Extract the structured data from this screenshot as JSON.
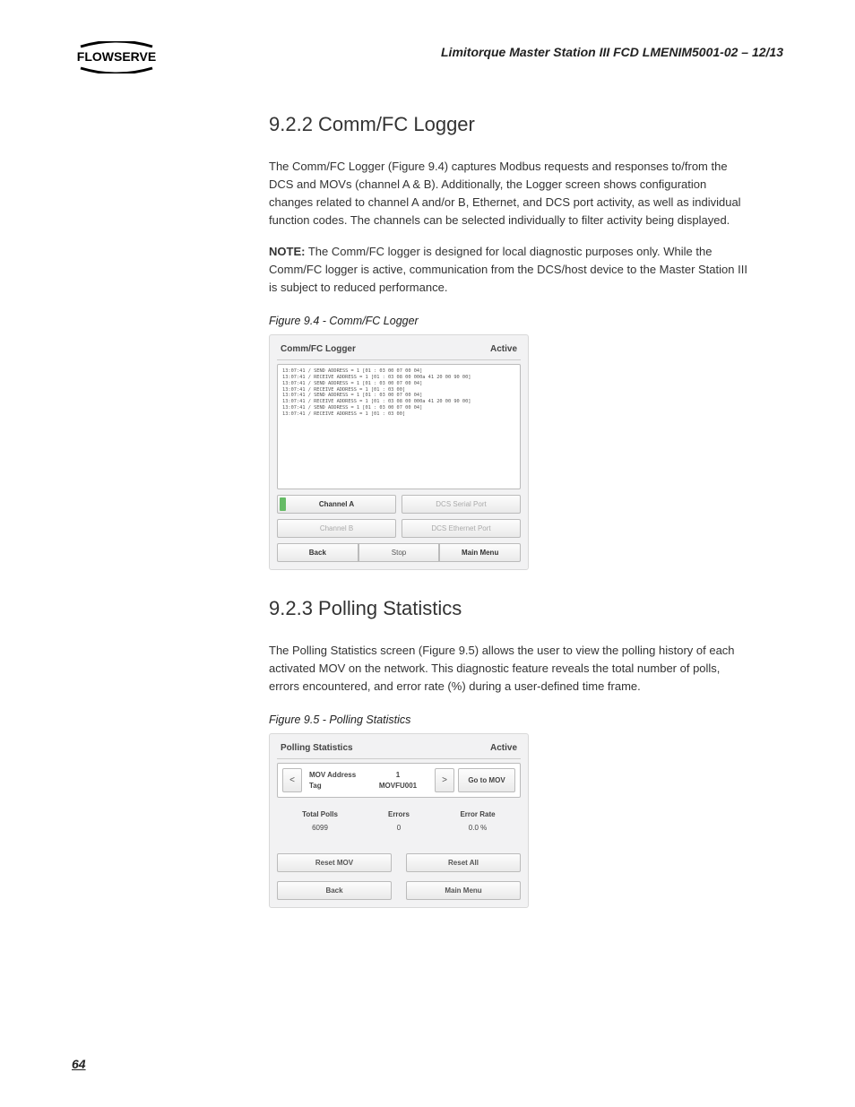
{
  "header": "Limitorque Master Station III    FCD LMENIM5001-02 – 12/13",
  "page_number": "64",
  "section1": {
    "heading": "9.2.2 Comm/FC Logger",
    "para1": "The Comm/FC Logger (Figure 9.4) captures Modbus requests and responses to/from the DCS and MOVs (channel A & B). Additionally, the Logger screen shows configuration changes related to channel A and/or B, Ethernet, and DCS port activity, as well as individual function codes. The channels can be selected individually to filter activity being displayed.",
    "note_label": "NOTE:",
    "note_body": " The Comm/FC logger is designed for local diagnostic purposes only. While the Comm/FC logger is active, communication from the DCS/host device to the Master Station III is subject to reduced performance.",
    "fig_caption": "Figure 9.4 - Comm/FC Logger"
  },
  "fig94": {
    "title": "Comm/FC Logger",
    "status": "Active",
    "log": "13:07:41 / SEND ADDRESS = 1 [01 : 03 00 07 00 04]\n13:07:41 / RECEIVE ADDRESS = 1 [01 : 03 08 00 000a 41 20 00 90 00]\n13:07:41 / SEND ADDRESS = 1 [01 : 03 00 07 00 04]\n13:07:41 / RECEIVE ADDRESS = 1 [01 : 03 00]\n13:07:41 / SEND ADDRESS = 1 [01 : 03 00 07 00 04]\n13:07:41 / RECEIVE ADDRESS = 1 [01 : 03 08 00 000a 41 20 00 90 00]\n13:07:41 / SEND ADDRESS = 1 [01 : 03 00 07 00 04]\n13:07:41 / RECEIVE ADDRESS = 1 [01 : 03 00]",
    "btn_channel_a": "Channel A",
    "btn_channel_b": "Channel B",
    "btn_dcs_serial": "DCS Serial Port",
    "btn_dcs_eth": "DCS Ethernet Port",
    "btn_back": "Back",
    "btn_stop": "Stop",
    "btn_main": "Main Menu"
  },
  "section2": {
    "heading": "9.2.3 Polling Statistics",
    "para1": "The Polling Statistics screen (Figure 9.5) allows the user to view the polling history of each activated MOV on the network. This diagnostic feature reveals the total number of polls, errors encountered, and error rate (%) during a user-defined time frame.",
    "fig_caption": "Figure 9.5 - Polling Statistics"
  },
  "fig95": {
    "title": "Polling Statistics",
    "status": "Active",
    "prev": "<",
    "next": ">",
    "mov_addr_label": "MOV Address",
    "mov_addr_value": "1",
    "tag_label": "Tag",
    "tag_value": "MOVFU001",
    "go_btn": "Go to MOV",
    "head_polls": "Total Polls",
    "head_errors": "Errors",
    "head_rate": "Error Rate",
    "val_polls": "6099",
    "val_errors": "0",
    "val_rate": "0.0 %",
    "btn_reset_mov": "Reset MOV",
    "btn_reset_all": "Reset All",
    "btn_back": "Back",
    "btn_main": "Main Menu"
  }
}
